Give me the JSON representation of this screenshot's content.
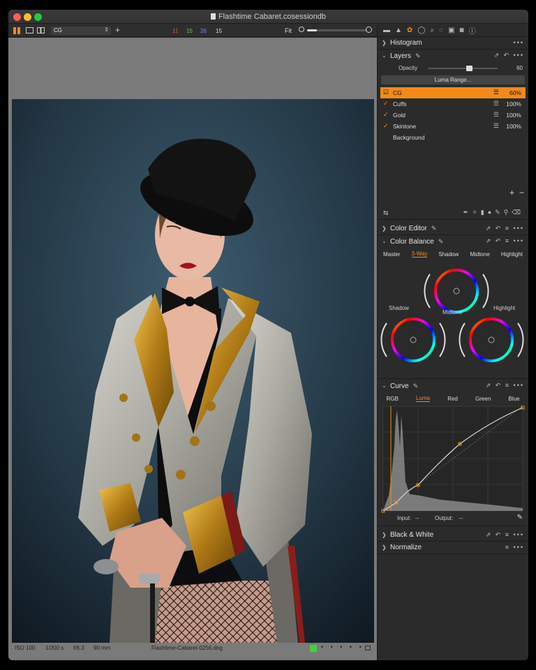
{
  "window": {
    "title": "Flashtime Cabaret.cosessiondb"
  },
  "toolbar": {
    "preset_value": "CG",
    "counts": [
      {
        "value": "11",
        "color": "#e0554a"
      },
      {
        "value": "15",
        "color": "#68cc5d"
      },
      {
        "value": "26",
        "color": "#6f8dea"
      },
      {
        "value": "15",
        "color": "#dddddd"
      }
    ],
    "zoom_label": "Fit"
  },
  "status": {
    "iso": "ISO 100",
    "shutter": "1/200 s",
    "aperture": "f/6.3",
    "focal": "90 mm",
    "filename": "Flashtime-Cabaret-0256.dng"
  },
  "panel": {
    "histogram": {
      "title": "Histogram"
    },
    "layers": {
      "title": "Layers",
      "opacity_label": "Opacity",
      "opacity_value": "60",
      "luma_range_label": "Luma Range...",
      "items": [
        {
          "name": "CG",
          "percent": "60%",
          "selected": true,
          "checked": true
        },
        {
          "name": "Cuffs",
          "percent": "100%",
          "selected": false,
          "checked": true
        },
        {
          "name": "Gold",
          "percent": "100%",
          "selected": false,
          "checked": true
        },
        {
          "name": "Skintone",
          "percent": "100%",
          "selected": false,
          "checked": true
        },
        {
          "name": "Background",
          "percent": "",
          "selected": false,
          "checked": false
        }
      ]
    },
    "color_editor": {
      "title": "Color Editor"
    },
    "color_balance": {
      "title": "Color Balance",
      "tabs": [
        "Master",
        "3-Way",
        "Shadow",
        "Midtone",
        "Highlight"
      ],
      "active_tab": "3-Way",
      "wheel_labels": {
        "shadow": "Shadow",
        "midtone": "Midtone",
        "highlight": "Highlight"
      }
    },
    "curve": {
      "title": "Curve",
      "tabs": [
        "RGB",
        "Luma",
        "Red",
        "Green",
        "Blue"
      ],
      "active_tab": "Luma",
      "input_label": "Input:",
      "input_value": "--",
      "output_label": "Output:",
      "output_value": "--"
    },
    "black_white": {
      "title": "Black & White"
    },
    "normalize": {
      "title": "Normalize"
    }
  },
  "colors": {
    "accent": "#f28a1a"
  }
}
